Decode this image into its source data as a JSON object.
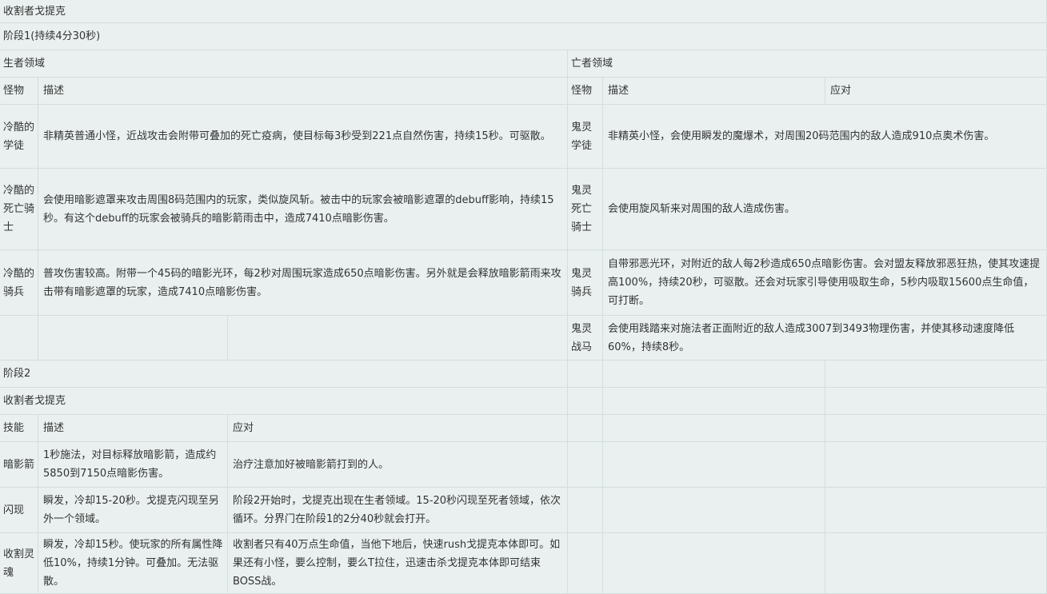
{
  "title": "收割者戈提克",
  "phase1": "阶段1(持续4分30秒)",
  "living_realm": "生者领域",
  "dead_realm": "亡者领域",
  "headers": {
    "monster": "怪物",
    "desc": "描述",
    "response": "应对",
    "skill": "技能"
  },
  "living_rows": [
    {
      "name": "冷酷的学徒",
      "desc": "非精英普通小怪，近战攻击会附带可叠加的死亡疫病，使目标每3秒受到221点自然伤害，持续15秒。可驱散。"
    },
    {
      "name": "冷酷的死亡骑士",
      "desc": "会使用暗影遮罩来攻击周围8码范围内的玩家，类似旋风斩。被击中的玩家会被暗影遮罩的debuff影响，持续15秒。有这个debuff的玩家会被骑兵的暗影箭雨击中，造成7410点暗影伤害。"
    },
    {
      "name": "冷酷的骑兵",
      "desc": "普攻伤害较高。附带一个45码的暗影光环，每2秒对周围玩家造成650点暗影伤害。另外就是会释放暗影箭雨来攻击带有暗影遮罩的玩家，造成7410点暗影伤害。"
    }
  ],
  "dead_rows": [
    {
      "name": "鬼灵学徒",
      "desc": "非精英小怪，会使用瞬发的魔爆术，对周围20码范围内的敌人造成910点奥术伤害。"
    },
    {
      "name": "鬼灵死亡骑士",
      "desc": "会使用旋风斩来对周围的敌人造成伤害。"
    },
    {
      "name": "鬼灵骑兵",
      "desc": "自带邪恶光环，对附近的敌人每2秒造成650点暗影伤害。会对盟友释放邪恶狂热，使其攻速提高100%，持续20秒，可驱散。还会对玩家引导使用吸取生命，5秒内吸取15600点生命值，可打断。"
    },
    {
      "name": "鬼灵战马",
      "desc": "会使用践踏来对施法者正面附近的敌人造成3007到3493物理伤害，并使其移动速度降低60%，持续8秒。"
    }
  ],
  "phase2": "阶段2",
  "boss": "收割者戈提克",
  "skills": [
    {
      "name": "暗影箭",
      "desc": "1秒施法，对目标释放暗影箭，造成约5850到7150点暗影伤害。",
      "response": "治疗注意加好被暗影箭打到的人。"
    },
    {
      "name": "闪现",
      "desc": "瞬发，冷却15-20秒。戈提克闪现至另外一个领域。",
      "response": "阶段2开始时，戈提克出现在生者领域。15-20秒闪现至死者领域，依次循环。分界门在阶段1的2分40秒就会打开。"
    },
    {
      "name": "收割灵魂",
      "desc": "瞬发，冷却15秒。使玩家的所有属性降低10%，持续1分钟。可叠加。无法驱散。",
      "response": "收割者只有40万点生命值，当他下地后，快速rush戈提克本体即可。如果还有小怪，要么控制，要么T拉住，迅速击杀戈提克本体即可结束BOSS战。"
    }
  ]
}
